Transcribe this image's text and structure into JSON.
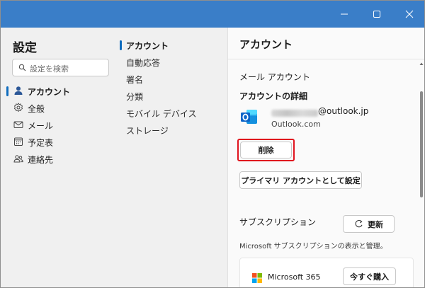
{
  "window": {
    "controls": [
      "minimize",
      "maximize",
      "close"
    ]
  },
  "sidebar": {
    "title": "設定",
    "search_placeholder": "設定を検索",
    "items": [
      {
        "label": "アカウント",
        "icon": "person-icon",
        "active": true
      },
      {
        "label": "全般",
        "icon": "gear-icon",
        "active": false
      },
      {
        "label": "メール",
        "icon": "mail-icon",
        "active": false
      },
      {
        "label": "予定表",
        "icon": "calendar-icon",
        "active": false
      },
      {
        "label": "連絡先",
        "icon": "people-icon",
        "active": false
      }
    ]
  },
  "subnav": {
    "items": [
      {
        "label": "アカウント",
        "active": true
      },
      {
        "label": "自動応答",
        "active": false
      },
      {
        "label": "署名",
        "active": false
      },
      {
        "label": "分類",
        "active": false
      },
      {
        "label": "モバイル デバイス",
        "active": false
      },
      {
        "label": "ストレージ",
        "active": false
      }
    ]
  },
  "pane": {
    "title": "アカウント",
    "section_label": "メール アカウント",
    "details_heading": "アカウントの詳細",
    "account_email_suffix": "@outlook.jp",
    "account_provider": "Outlook.com",
    "delete_button": "削除",
    "primary_button": "プライマリ アカウントとして設定",
    "subscription_title": "サブスクリプション",
    "refresh_button": "更新",
    "subscription_desc": "Microsoft サブスクリプションの表示と管理。",
    "product_name": "Microsoft 365",
    "buy_button": "今すぐ購入"
  },
  "colors": {
    "titlebar": "#3a7ec8",
    "accent": "#0f6cbd",
    "highlight_border": "#e0141e"
  }
}
